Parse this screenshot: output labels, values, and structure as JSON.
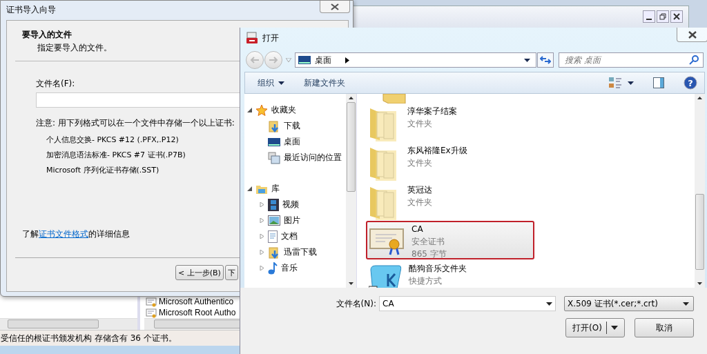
{
  "background_window": {
    "list_items": [
      "Microsoft Authentico",
      "Microsoft Root Autho"
    ],
    "status_bar": "受信任的根证书颁发机构 存储含有 36 个证书。"
  },
  "wizard": {
    "title": "证书导入向导",
    "heading": "要导入的文件",
    "subheading": "指定要导入的文件。",
    "file_label": "文件名(F):",
    "note": "注意: 用下列格式可以在一个文件中存储一个以上证书:",
    "formats": [
      "个人信息交换- PKCS #12 (.PFX,.P12)",
      "加密消息语法标准- PKCS #7 证书(.P7B)",
      "Microsoft 序列化证书存储(.SST)"
    ],
    "info": {
      "before": "了解",
      "link": "证书文件格式",
      "after": "的详细信息"
    },
    "buttons": [
      "< 上一步(B)",
      "下"
    ]
  },
  "open_dialog": {
    "title": "打开",
    "location": "桌面",
    "search_placeholder": "搜索 桌面",
    "toolbar": [
      {
        "label": "组织",
        "kind": "menu"
      },
      {
        "label": "新建文件夹",
        "kind": "plain"
      }
    ],
    "tree": [
      {
        "label": "收藏夹",
        "expanded": true,
        "children": [
          {
            "label": "下载"
          },
          {
            "label": "桌面"
          },
          {
            "label": "最近访问的位置"
          }
        ]
      },
      {
        "label": "库",
        "expanded": true,
        "children": [
          {
            "label": "视频",
            "expanded": false
          },
          {
            "label": "图片",
            "expanded": false
          },
          {
            "label": "文档",
            "expanded": false
          },
          {
            "label": "迅雷下载",
            "expanded": false
          },
          {
            "label": "音乐",
            "expanded": false
          }
        ]
      }
    ],
    "files": [
      {
        "name": "淳华案子结案",
        "type": "文件夹",
        "kind": "folder",
        "selected": false
      },
      {
        "name": "东风裕隆Ex升级",
        "type": "文件夹",
        "kind": "folder",
        "selected": false
      },
      {
        "name": "英冠达",
        "type": "文件夹",
        "kind": "folder",
        "selected": false
      },
      {
        "name": "CA",
        "type": "安全证书",
        "size": "865 字节",
        "kind": "certificate",
        "selected": true
      },
      {
        "name": "酷狗音乐文件夹",
        "type": "快捷方式",
        "kind": "shortcut",
        "selected": false
      }
    ],
    "filename_label": "文件名(N):",
    "filename_value": "CA",
    "file_type": "X.509 证书(*.cer;*.crt)",
    "help_glyph": "?",
    "buttons": [
      {
        "label": "打开(O)",
        "kind": "split"
      },
      {
        "label": "取消",
        "kind": "plain"
      }
    ]
  }
}
